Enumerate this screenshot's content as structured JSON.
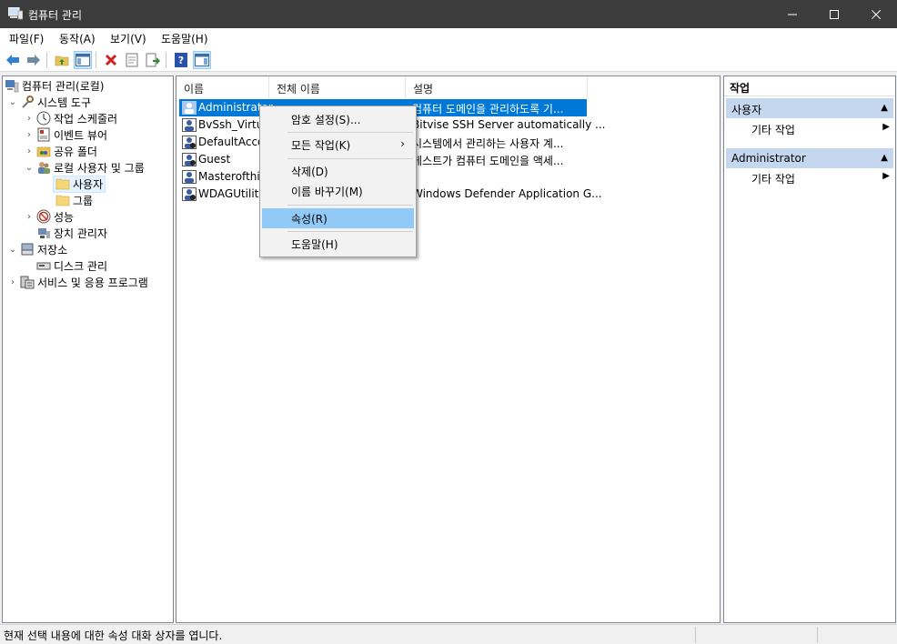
{
  "window": {
    "title": "컴퓨터 관리",
    "minimize_icon": "minimize-icon",
    "maximize_icon": "maximize-icon",
    "close_icon": "close-icon"
  },
  "menu": [
    "파일(F)",
    "동작(A)",
    "보기(V)",
    "도움말(H)"
  ],
  "toolbar": [
    "back-arrow-icon",
    "forward-arrow-icon",
    "up-folder-icon",
    "show-hide-tree-icon",
    "delete-icon",
    "properties-icon",
    "export-list-icon",
    "help-icon",
    "show-hide-action-pane-icon"
  ],
  "tree": {
    "root": "컴퓨터 관리(로컬)",
    "system_tools": "시스템 도구",
    "task_scheduler": "작업 스케줄러",
    "event_viewer": "이벤트 뷰어",
    "shared_folders": "공유 폴더",
    "local_users_groups": "로컬 사용자 및 그룹",
    "users": "사용자",
    "groups": "그룹",
    "performance": "성능",
    "device_manager": "장치 관리자",
    "storage": "저장소",
    "disk_management": "디스크 관리",
    "services_apps": "서비스 및 응용 프로그램"
  },
  "list": {
    "columns": [
      "이름",
      "전체 이름",
      "설명"
    ],
    "rows": [
      {
        "name": "Administrator",
        "description": "컴퓨터 도메인을 관리하도록 기..."
      },
      {
        "name": "BvSsh_Virtu...",
        "description": "Bitvise SSH Server automatically ..."
      },
      {
        "name": "DefaultAcco...",
        "description": "시스템에서 관리하는 사용자 계..."
      },
      {
        "name": "Guest",
        "description": "게스트가 컴퓨터 도메인을 액세..."
      },
      {
        "name": "Masterofthis",
        "description": ""
      },
      {
        "name": "WDAGUtility...",
        "description": "Windows Defender Application G..."
      }
    ]
  },
  "context_menu": {
    "set_password": "암호 설정(S)...",
    "all_tasks": "모든 작업(K)",
    "delete": "삭제(D)",
    "rename": "이름 바꾸기(M)",
    "properties": "속성(R)",
    "help": "도움말(H)"
  },
  "actions": {
    "header": "작업",
    "group1": "사용자",
    "group1_more": "기타 작업",
    "group2": "Administrator",
    "group2_more": "기타 작업"
  },
  "status": {
    "text": "현재 선택 내용에 대한 속성 대화 상자를 엽니다."
  },
  "colors": {
    "title_bar": "#3c3c3c",
    "selection": "#0078d7",
    "menu_highlight": "#91c9f7",
    "action_group": "#c4d7ee"
  }
}
